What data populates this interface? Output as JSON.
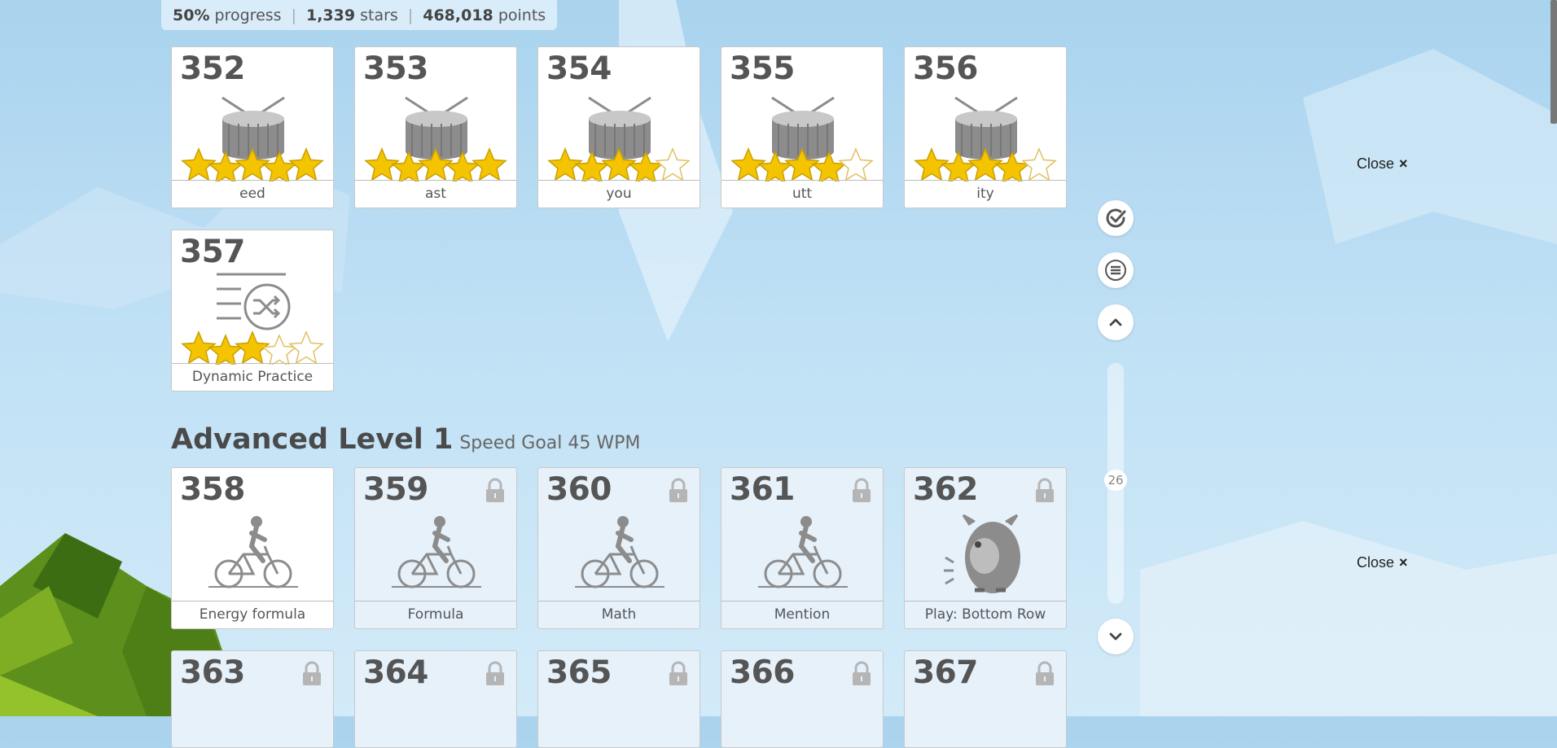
{
  "stats": {
    "progress_value": "50%",
    "progress_label": "progress",
    "stars_value": "1,339",
    "stars_label": "stars",
    "points_value": "468,018",
    "points_label": "points"
  },
  "lessons_top": [
    {
      "number": "352",
      "label": "eed",
      "stars": 5,
      "icon": "drum-icon",
      "locked": false
    },
    {
      "number": "353",
      "label": "ast",
      "stars": 5,
      "icon": "drum-icon",
      "locked": false
    },
    {
      "number": "354",
      "label": "you",
      "stars": 4,
      "icon": "drum-icon",
      "locked": false
    },
    {
      "number": "355",
      "label": "utt",
      "stars": 4,
      "icon": "drum-icon",
      "locked": false
    },
    {
      "number": "356",
      "label": "ity",
      "stars": 4,
      "icon": "drum-icon",
      "locked": false
    },
    {
      "number": "357",
      "label": "Dynamic Practice",
      "stars": 3,
      "icon": "shuffle-practice-icon",
      "locked": false
    }
  ],
  "section": {
    "title": "Advanced Level 1",
    "subtitle": "Speed Goal 45 WPM"
  },
  "lessons_advanced": [
    {
      "number": "358",
      "label": "Energy formula",
      "icon": "cyclist-icon",
      "locked": false
    },
    {
      "number": "359",
      "label": "Formula",
      "icon": "cyclist-icon",
      "locked": true
    },
    {
      "number": "360",
      "label": "Math",
      "icon": "cyclist-icon",
      "locked": true
    },
    {
      "number": "361",
      "label": "Mention",
      "icon": "cyclist-icon",
      "locked": true
    },
    {
      "number": "362",
      "label": "Play: Bottom Row",
      "icon": "monster-icon",
      "locked": true
    }
  ],
  "lessons_bottom": [
    {
      "number": "363",
      "locked": true
    },
    {
      "number": "364",
      "locked": true
    },
    {
      "number": "365",
      "locked": true
    },
    {
      "number": "366",
      "locked": true
    },
    {
      "number": "367",
      "locked": true
    }
  ],
  "sidebar": {
    "scroll_position": "26"
  },
  "close_label": "Close",
  "close_symbol": "×",
  "colors": {
    "star": "#f5c400",
    "star_outline": "#c9a000",
    "icon_gray": "#8c8c8c",
    "bg_sky": "#bfe0f5"
  }
}
